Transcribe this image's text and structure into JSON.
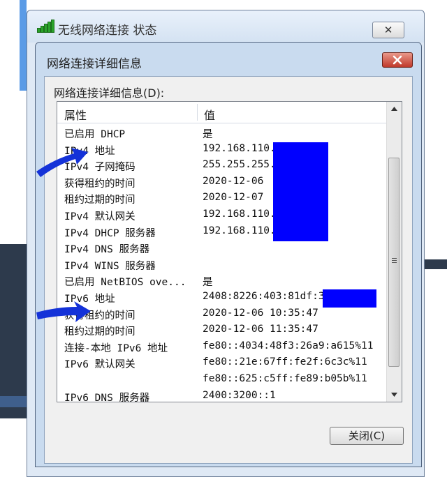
{
  "background_window": {
    "title": "无线网络连接 状态",
    "close_label": "✕"
  },
  "dialog": {
    "title": "网络连接详细信息",
    "list_label": "网络连接详细信息(D):",
    "columns": {
      "property": "属性",
      "value": "值"
    },
    "rows": [
      {
        "property": "已启用 DHCP",
        "value": "是"
      },
      {
        "property": "IPv4 地址",
        "value": "192.168.110."
      },
      {
        "property": "IPv4 子网掩码",
        "value": "255.255.255."
      },
      {
        "property": "获得租约的时间",
        "value": "2020-12-06"
      },
      {
        "property": "租约过期的时间",
        "value": "2020-12-07"
      },
      {
        "property": "IPv4 默认网关",
        "value": "192.168.110."
      },
      {
        "property": "IPv4 DHCP 服务器",
        "value": "192.168.110."
      },
      {
        "property": "IPv4 DNS 服务器",
        "value": ""
      },
      {
        "property": "IPv4 WINS 服务器",
        "value": ""
      },
      {
        "property": "已启用 NetBIOS ove...",
        "value": "是"
      },
      {
        "property": "IPv6 地址",
        "value": "2408:8226:403:81df:3"
      },
      {
        "property": "获得租约的时间",
        "value": "2020-12-06 10:35:47"
      },
      {
        "property": "租约过期的时间",
        "value": "2020-12-06 11:35:47"
      },
      {
        "property": "连接-本地 IPv6 地址",
        "value": "fe80::4034:48f3:26a9:a615%11"
      },
      {
        "property": "IPv6 默认网关",
        "value": "fe80::21e:67ff:fe2f:6c3c%11"
      },
      {
        "property": "",
        "value": "fe80::625:c5ff:fe89:b05b%11"
      },
      {
        "property": "IPv6 DNS 服务器",
        "value": "2400:3200::1"
      }
    ],
    "close_button_label": "关闭(C)"
  },
  "colors": {
    "redaction": "#0000ff",
    "arrow": "#1432d8",
    "dialog_frame": "#c9dbef",
    "close_x": "#c0392b"
  },
  "icons": [
    "wifi-signal-icon",
    "close-icon",
    "scroll-up-icon",
    "scroll-down-icon",
    "arrow-pointer-icon"
  ]
}
